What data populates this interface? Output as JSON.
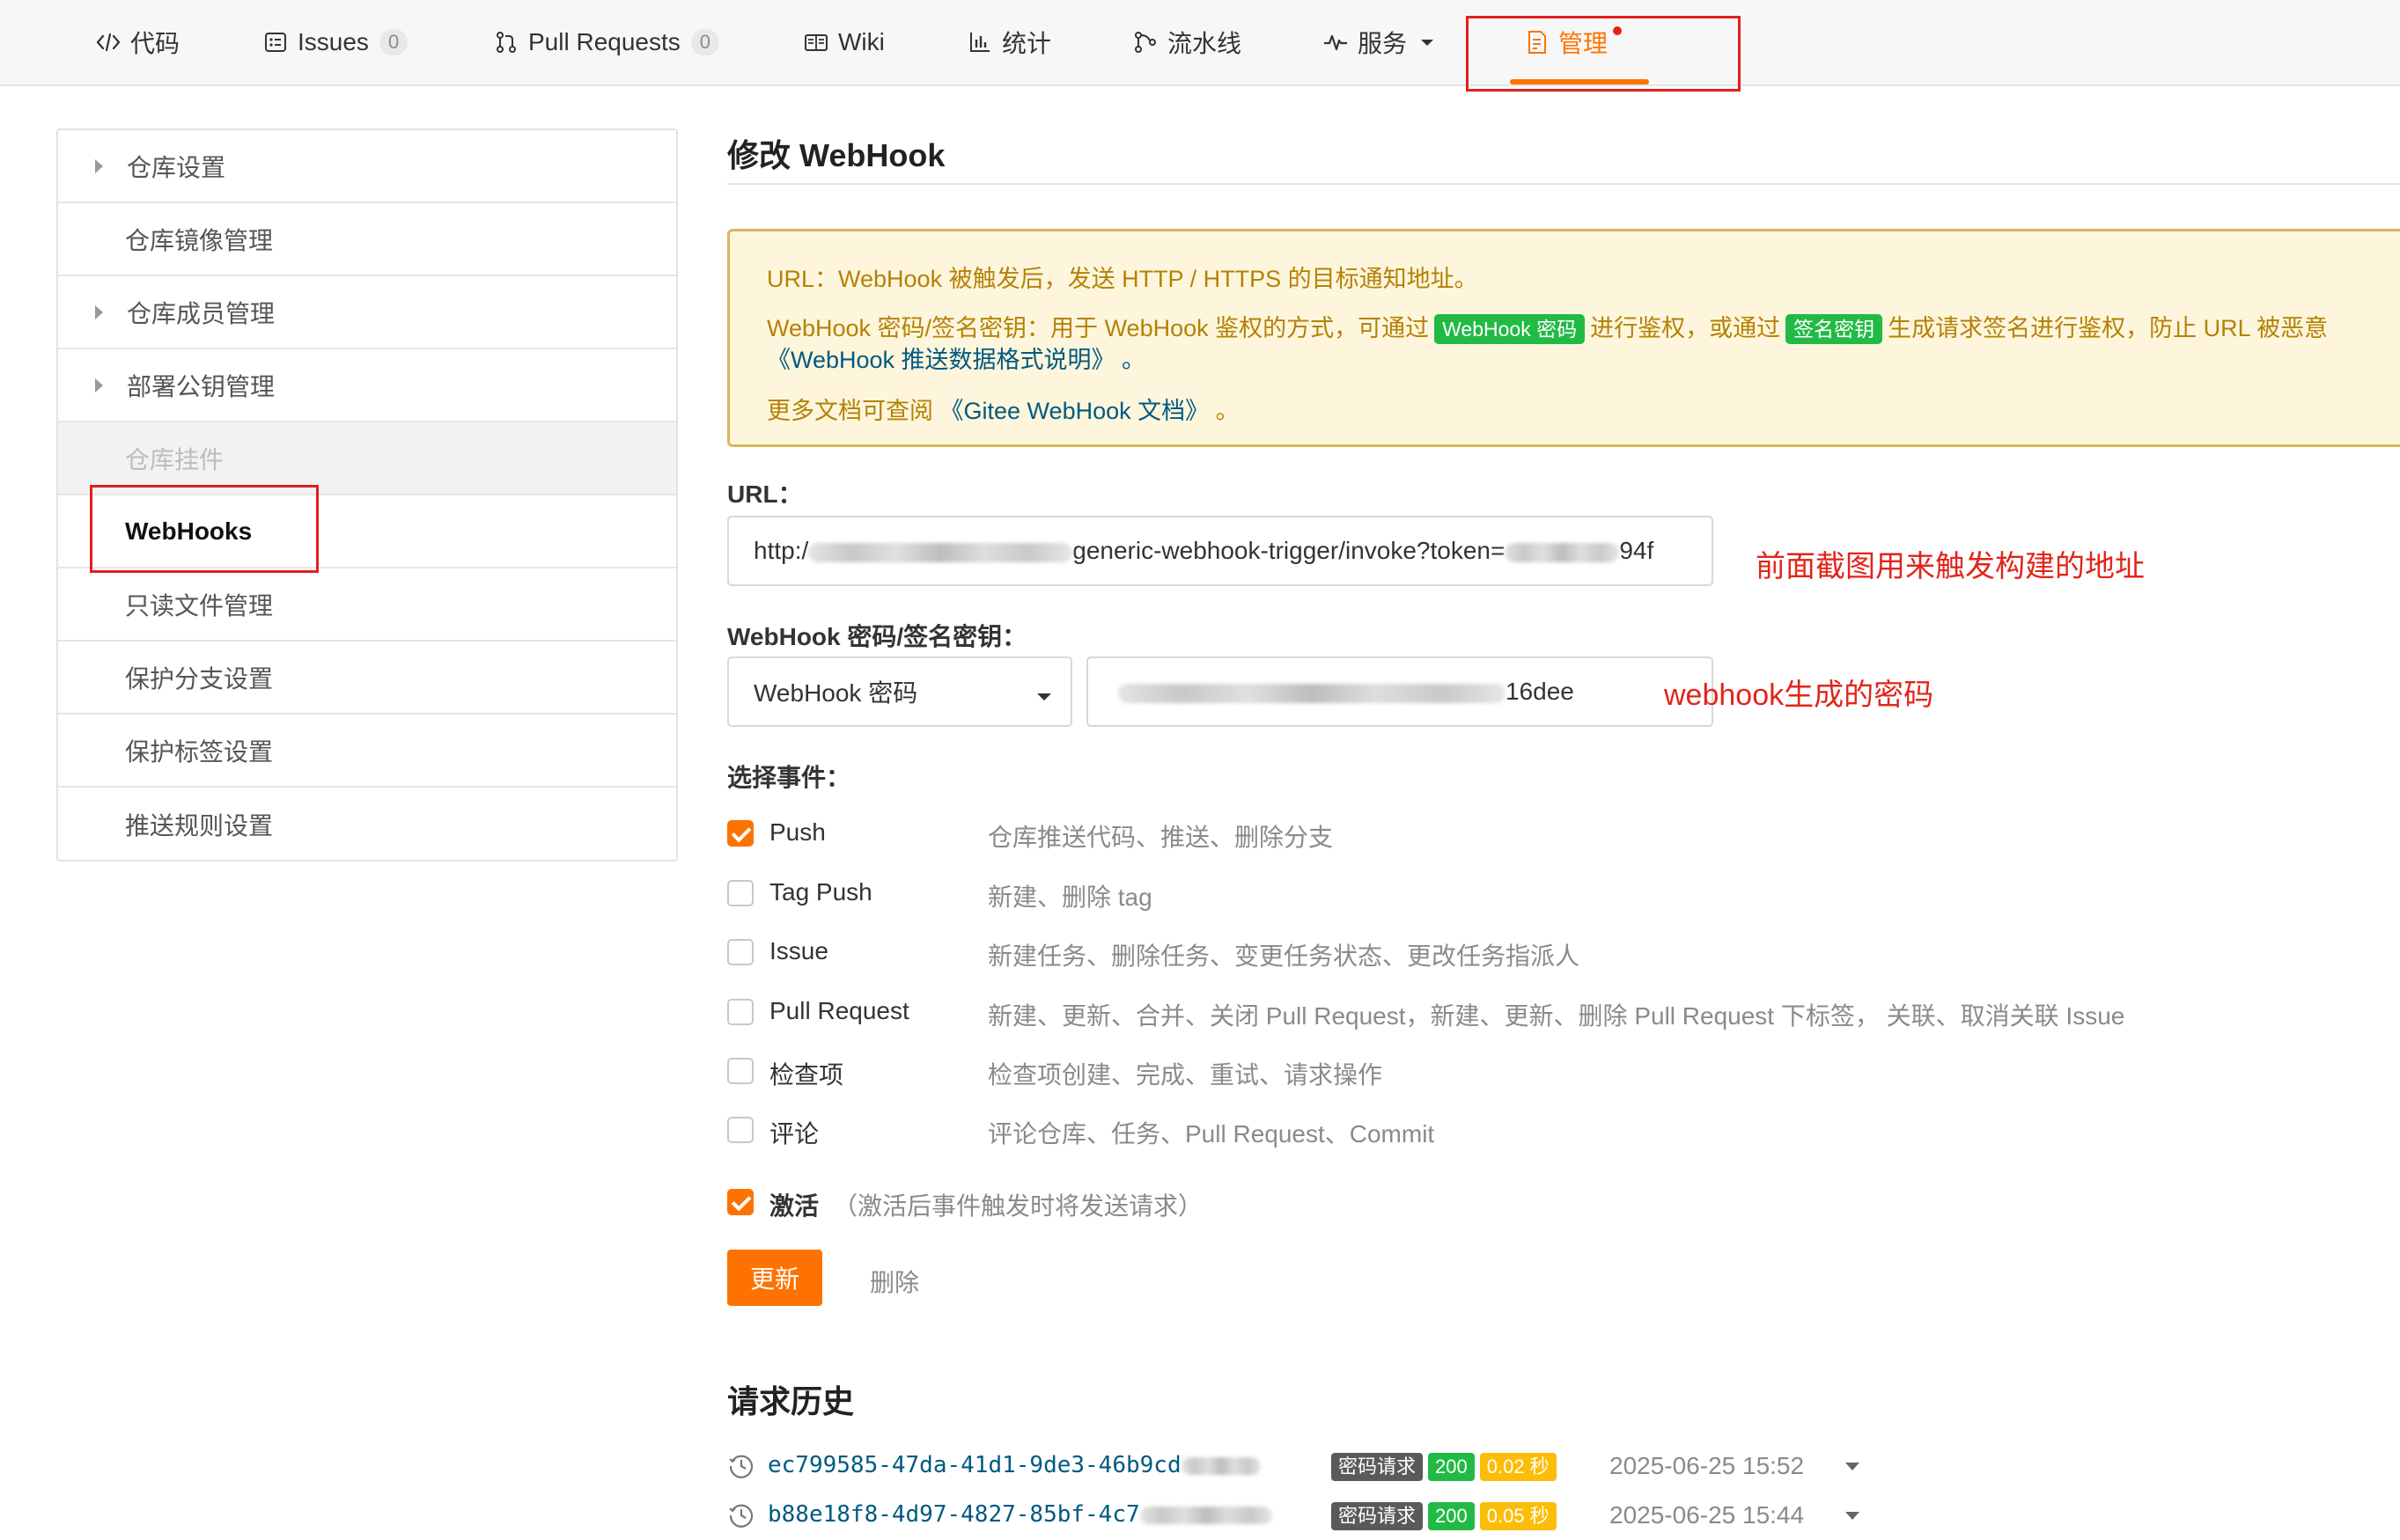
{
  "nav": {
    "tabs": [
      {
        "label": "代码",
        "icon": "code-icon"
      },
      {
        "label": "Issues",
        "icon": "issues-icon",
        "count": "0"
      },
      {
        "label": "Pull Requests",
        "icon": "pull-request-icon",
        "count": "0"
      },
      {
        "label": "Wiki",
        "icon": "wiki-icon"
      },
      {
        "label": "统计",
        "icon": "stats-icon"
      },
      {
        "label": "流水线",
        "icon": "pipeline-icon"
      },
      {
        "label": "服务",
        "icon": "service-icon"
      },
      {
        "label": "管理",
        "icon": "manage-icon",
        "active": true
      }
    ]
  },
  "sidebar": {
    "items": [
      {
        "label": "仓库设置",
        "expandable": true
      },
      {
        "label": "仓库镜像管理"
      },
      {
        "label": "仓库成员管理",
        "expandable": true
      },
      {
        "label": "部署公钥管理",
        "expandable": true
      },
      {
        "label": "仓库挂件",
        "disabled": true
      },
      {
        "label": "WebHooks",
        "selected": true
      },
      {
        "label": "只读文件管理"
      },
      {
        "label": "保护分支设置"
      },
      {
        "label": "保护标签设置"
      },
      {
        "label": "推送规则设置"
      }
    ]
  },
  "page": {
    "title": "修改 WebHook"
  },
  "notice": {
    "line1": "URL：WebHook 被触发后，发送 HTTP / HTTPS 的目标通知地址。",
    "line2_pre": "WebHook 密码/签名密钥：用于 WebHook 鉴权的方式，可通过",
    "line2_pill1": "WebHook 密码",
    "line2_mid": "进行鉴权，或通过",
    "line2_pill2": "签名密钥",
    "line2_post": "生成请求签名进行鉴权，防止 URL 被恶意",
    "line3": "《WebHook 推送数据格式说明》 。",
    "line4_pre": "更多文档可查阅",
    "line4_link": "《Gitee WebHook 文档》",
    "line4_post": " 。"
  },
  "form": {
    "url_label": "URL：",
    "url_value_start": "http:/",
    "url_value_mid": "generic-webhook-trigger/invoke?token=",
    "url_value_end": "94f",
    "url_annotation": "前面截图用来触发构建的地址",
    "secret_label": "WebHook 密码/签名密钥：",
    "secret_type": "WebHook 密码",
    "secret_value_end": "16dee",
    "secret_annotation": "webhook生成的密码",
    "events_label": "选择事件："
  },
  "events": [
    {
      "name": "Push",
      "desc": "仓库推送代码、推送、删除分支",
      "checked": true
    },
    {
      "name": "Tag Push",
      "desc": "新建、删除 tag",
      "checked": false
    },
    {
      "name": "Issue",
      "desc": "新建任务、删除任务、变更任务状态、更改任务指派人",
      "checked": false
    },
    {
      "name": "Pull Request",
      "desc": "新建、更新、合并、关闭 Pull Request，新建、更新、删除 Pull Request 下标签， 关联、取消关联 Issue",
      "checked": false
    },
    {
      "name": "检查项",
      "desc": "检查项创建、完成、重试、请求操作",
      "checked": false
    },
    {
      "name": "评论",
      "desc": "评论仓库、任务、Pull Request、Commit",
      "checked": false
    }
  ],
  "activate": {
    "label": "激活",
    "note": "（激活后事件触发时将发送请求）",
    "checked": true
  },
  "actions": {
    "update": "更新",
    "delete": "删除"
  },
  "history": {
    "title": "请求历史",
    "rows": [
      {
        "id": "ec799585-47da-41d1-9de3-46b9",
        "id_tail": "cd",
        "type": "密码请求",
        "status": "200",
        "duration": "0.02 秒",
        "time": "2025-06-25 15:52"
      },
      {
        "id": "b88e18f8-4d97-4827-85bf-4c7",
        "id_tail": "",
        "type": "密码请求",
        "status": "200",
        "duration": "0.05 秒",
        "time": "2025-06-25 15:44"
      }
    ]
  },
  "colors": {
    "accent": "#fe7300",
    "annotation_red": "#e1251b",
    "success_green": "#21ba45",
    "warning_yellow": "#fbbd08",
    "link_blue": "#005980"
  }
}
